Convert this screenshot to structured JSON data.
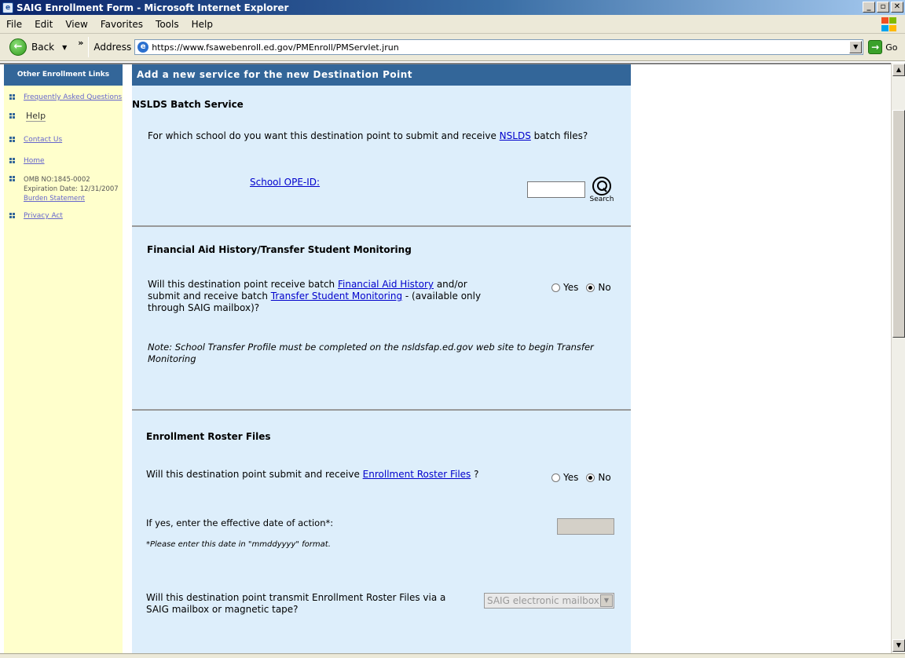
{
  "window": {
    "title": "SAIG Enrollment Form - Microsoft Internet Explorer",
    "min": "_",
    "max": "▫",
    "close": "✕"
  },
  "menu": {
    "file": "File",
    "edit": "Edit",
    "view": "View",
    "favorites": "Favorites",
    "tools": "Tools",
    "help": "Help"
  },
  "toolbar": {
    "back": "Back",
    "address_label": "Address",
    "url": "https://www.fsawebenroll.ed.gov/PMEnroll/PMServlet.jrun",
    "go": "Go"
  },
  "sidebar": {
    "header": "Other Enrollment Links",
    "faq": "Frequently Asked Questions",
    "help": "Help",
    "contact": "Contact Us",
    "home": "Home",
    "omb": "OMB NO:1845-0002",
    "expiration": "Expiration Date: 12/31/2007",
    "burden": "Burden Statement",
    "privacy": "Privacy Act"
  },
  "main": {
    "header": "Add a new service for the new Destination Point",
    "nslds": {
      "title": "NSLDS Batch Service",
      "question_pre": "For which school do you want this destination point to submit and receive ",
      "question_link": "NSLDS",
      "question_post": " batch files?",
      "opeid_label": "School OPE-ID:",
      "search_label": "Search"
    },
    "fah": {
      "title": "Financial Aid History/Transfer Student Monitoring",
      "q_pre": "Will this destination point receive batch ",
      "q_link1": "Financial Aid History",
      "q_mid": " and/or submit and receive batch ",
      "q_link2": "Transfer Student Monitoring",
      "q_post": " - (available only through SAIG mailbox)?",
      "yes": "Yes",
      "no": "No",
      "note": "Note: School Transfer Profile must be completed on the nsldsfap.ed.gov web site to begin Transfer Monitoring"
    },
    "roster": {
      "title": "Enrollment Roster Files",
      "q_pre": "Will this destination point submit and receive ",
      "q_link": "Enrollment Roster Files",
      "q_post": " ?",
      "yes": "Yes",
      "no": "No",
      "date_label": "If yes, enter the effective date of action*:",
      "date_hint": "*Please enter this date in \"mmddyyyy\" format.",
      "transmit_q": "Will this destination point transmit Enrollment Roster Files via a SAIG mailbox or magnetic tape?",
      "transmit_value": "SAIG electronic mailbox"
    }
  },
  "colors": {
    "header_blue": "#336699",
    "sidebar_bg": "#ffffcc",
    "main_bg": "#ddeefb",
    "link": "#0000cc"
  }
}
